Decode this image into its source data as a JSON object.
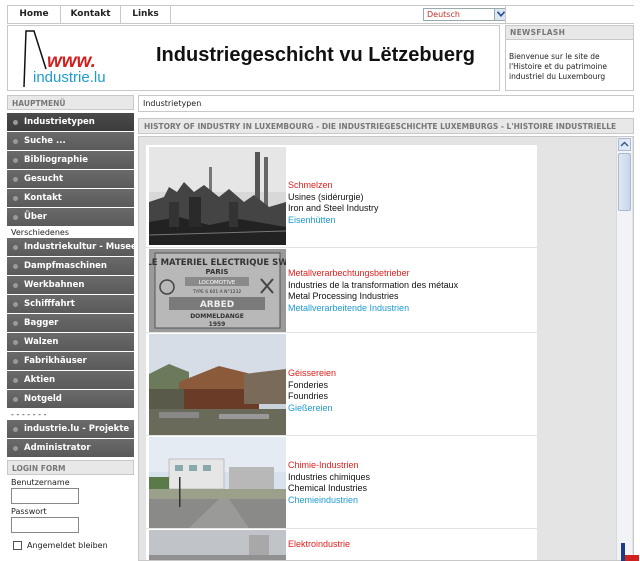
{
  "nav": {
    "home": "Home",
    "kontakt": "Kontakt",
    "links": "Links",
    "language": "Deutsch"
  },
  "header": {
    "logo_text": "www.industrie.lu",
    "title": "Industriegeschicht vu Lëtzebuerg"
  },
  "newsflash": {
    "title": "NEWSFLASH",
    "text": "Bienvenue sur le site de l'Histoire et du patrimoine industriel du  Luxembourg"
  },
  "sidebar": {
    "main_menu_title": "HAUPTMENÜ",
    "main_items": [
      {
        "label": "Industrietypen"
      },
      {
        "label": "Suche ..."
      },
      {
        "label": "Bibliographie"
      },
      {
        "label": "Gesucht"
      },
      {
        "label": "Kontakt"
      },
      {
        "label": "Über"
      }
    ],
    "section_label": "Verschiedenes",
    "misc_items": [
      {
        "label": "Industriekultur - Museen"
      },
      {
        "label": "Dampfmaschinen"
      },
      {
        "label": "Werkbahnen"
      },
      {
        "label": "Schifffahrt"
      },
      {
        "label": "Bagger"
      },
      {
        "label": "Walzen"
      },
      {
        "label": "Fabrikhäuser"
      },
      {
        "label": "Aktien"
      },
      {
        "label": "Notgeld"
      }
    ],
    "separator": "- - - - - - -",
    "project_items": [
      {
        "label": "industrie.lu - Projekte"
      },
      {
        "label": "Administrator"
      }
    ],
    "login_title": "LOGIN FORM",
    "username_label": "Benutzername",
    "password_label": "Passwort",
    "remember_label": "Angemeldet bleiben"
  },
  "breadcrumb": "Industrietypen",
  "content": {
    "header": "HISTORY OF INDUSTRY IN LUXEMBOURG - DIE INDUSTRIEGESCHICHTE LUXEMBURGS - L'HISTOIRE INDUSTRIELLE",
    "plate": {
      "line1": "LE MATERIEL ELECTRIQUE SW",
      "line2": "PARIS",
      "line3": "LOCOMOTIVE",
      "line4": "TYPE 6 601 A N°1232",
      "line5": "ARBED",
      "line6": "DOMMELDANGE",
      "line7": "1959"
    },
    "categories": [
      {
        "title": "Schmelzen",
        "fr": "Usines (sidérurgie)",
        "en": "Iron and Steel Industry",
        "de": "Eisenhütten"
      },
      {
        "title": "Metallverarbechtungsbetrieber",
        "fr": "Industries de la transformation des métaux",
        "en": "Metal Processing Industries",
        "de": "Metallverarbeitende Industrien"
      },
      {
        "title": "Géissereien",
        "fr": "Fonderies",
        "en": "Foundries",
        "de": "Gießereien"
      },
      {
        "title": "Chimie-Industrien",
        "fr": "Industries chimiques",
        "en": "Chemical Industries",
        "de": "Chemieindustrien"
      },
      {
        "title": "Elektroindustrie"
      }
    ]
  }
}
